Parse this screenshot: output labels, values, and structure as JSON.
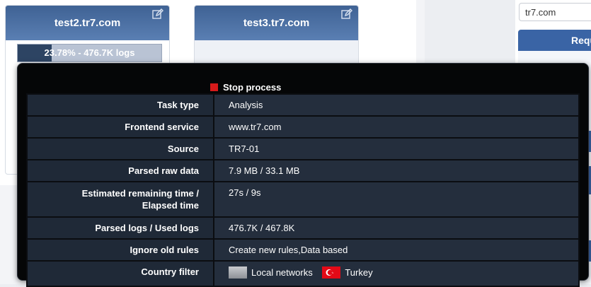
{
  "cards": [
    {
      "title": "test2.tr7.com",
      "progress_percent": 23.78,
      "progress_text": "23.78% - 476.7K logs"
    },
    {
      "title": "test3.tr7.com"
    }
  ],
  "search": {
    "value": "tr7.com"
  },
  "right_panel": {
    "header": "Requ"
  },
  "tooltip": {
    "stop_label": "Stop process",
    "rows": [
      {
        "label": "Task type",
        "value": "Analysis"
      },
      {
        "label": "Frontend service",
        "value": "www.tr7.com"
      },
      {
        "label": "Source",
        "value": "TR7-01"
      },
      {
        "label": "Parsed raw data",
        "value": "7.9 MB / 33.1 MB"
      },
      {
        "label": "Estimated remaining time /\nElapsed time",
        "value": "27s / 9s"
      },
      {
        "label": "Parsed logs / Used logs",
        "value": "476.7K / 467.8K"
      },
      {
        "label": "Ignore old rules",
        "value": "Create new rules,Data based"
      },
      {
        "label": "Country filter"
      }
    ],
    "countries": [
      {
        "name": "Local networks",
        "icon": "local-network-flag-icon"
      },
      {
        "name": "Turkey",
        "icon": "turkey-flag-icon"
      }
    ]
  },
  "colors": {
    "card_header": "#3f6294",
    "tooltip_bg": "#050607",
    "stop": "#d61a1a",
    "accent": "#3a64a5"
  }
}
